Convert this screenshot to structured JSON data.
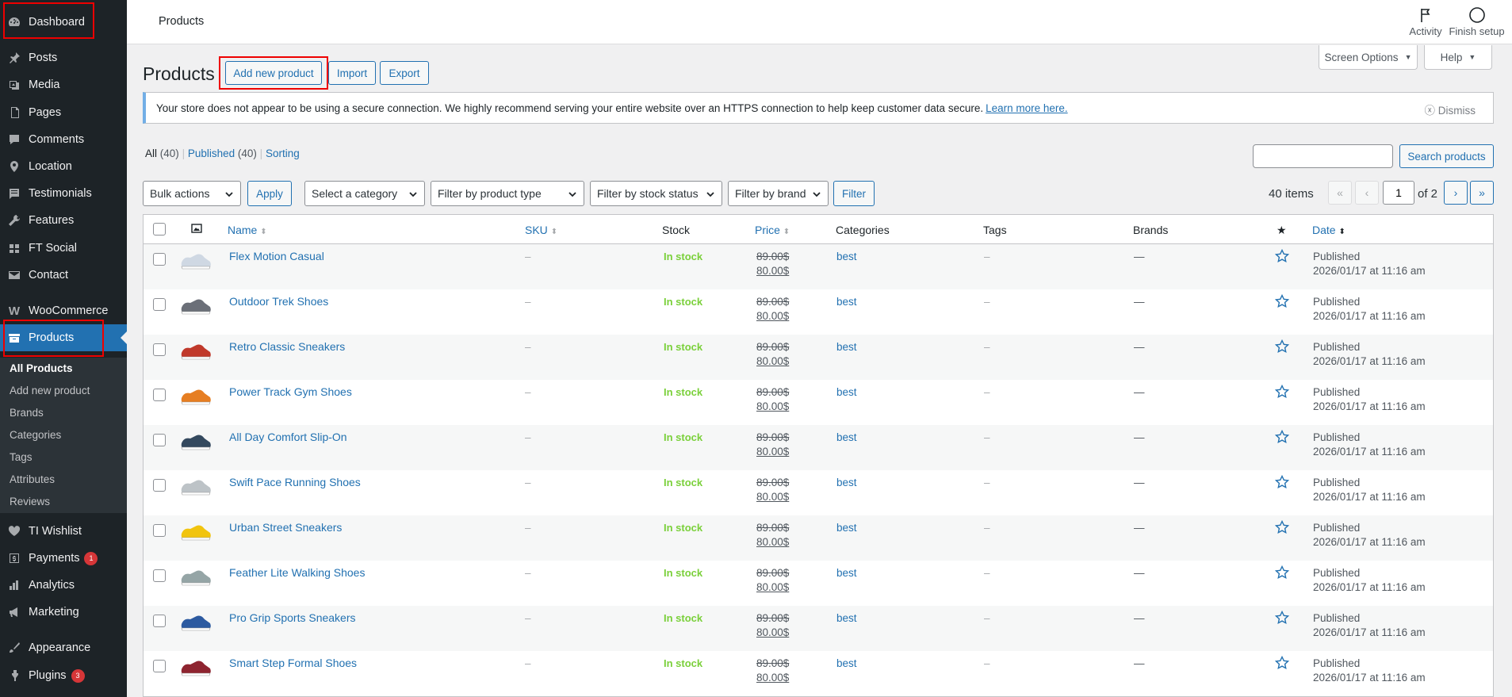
{
  "sidebar": {
    "items": [
      {
        "label": "Dashboard",
        "icon": "dashboard-icon"
      },
      {
        "label": "Posts",
        "icon": "pin-icon"
      },
      {
        "label": "Media",
        "icon": "media-icon"
      },
      {
        "label": "Pages",
        "icon": "pages-icon"
      },
      {
        "label": "Comments",
        "icon": "comments-icon"
      },
      {
        "label": "Location",
        "icon": "location-icon"
      },
      {
        "label": "Testimonials",
        "icon": "testimonials-icon"
      },
      {
        "label": "Features",
        "icon": "wrench-icon"
      },
      {
        "label": "FT Social",
        "icon": "social-icon"
      },
      {
        "label": "Contact",
        "icon": "mail-icon"
      },
      {
        "label": "WooCommerce",
        "icon": "woocommerce-icon"
      },
      {
        "label": "Products",
        "icon": "products-icon"
      },
      {
        "label": "TI Wishlist",
        "icon": "heart-icon"
      },
      {
        "label": "Payments",
        "icon": "payments-icon",
        "badge": "1"
      },
      {
        "label": "Analytics",
        "icon": "analytics-icon"
      },
      {
        "label": "Marketing",
        "icon": "megaphone-icon"
      },
      {
        "label": "Appearance",
        "icon": "brush-icon"
      },
      {
        "label": "Plugins",
        "icon": "plugin-icon",
        "badge": "3"
      }
    ],
    "submenu": [
      "All Products",
      "Add new product",
      "Brands",
      "Categories",
      "Tags",
      "Attributes",
      "Reviews"
    ]
  },
  "topbar": {
    "title": "Products",
    "activity": "Activity",
    "finish_setup": "Finish setup"
  },
  "screen_options": "Screen Options",
  "help": "Help",
  "heading": {
    "title": "Products",
    "add_new": "Add new product",
    "import": "Import",
    "export": "Export"
  },
  "notice": {
    "text": "Your store does not appear to be using a secure connection. We highly recommend serving your entire website over an HTTPS connection to help keep customer data secure.",
    "link": "Learn more here.",
    "dismiss": "Dismiss"
  },
  "views": {
    "all": "All",
    "all_count": "(40)",
    "published": "Published",
    "published_count": "(40)",
    "sorting": "Sorting"
  },
  "search": {
    "button": "Search products",
    "value": ""
  },
  "filters": {
    "bulk": "Bulk actions",
    "apply": "Apply",
    "category": "Select a category",
    "type": "Filter by product type",
    "stock": "Filter by stock status",
    "brand": "Filter by brand",
    "filter": "Filter"
  },
  "pagination": {
    "items": "40 items",
    "current": "1",
    "of": "of 2",
    "first": "«",
    "prev": "‹",
    "next": "›",
    "last": "»"
  },
  "columns": {
    "name": "Name",
    "sku": "SKU",
    "stock": "Stock",
    "price": "Price",
    "categories": "Categories",
    "tags": "Tags",
    "brands": "Brands",
    "date": "Date"
  },
  "products": [
    {
      "name": "Flex Motion Casual",
      "sku": "–",
      "stock": "In stock",
      "price_old": "89.00$",
      "price_new": "80.00$",
      "category": "best",
      "tags": "–",
      "brands": "—",
      "status": "Published",
      "date": "2026/01/17 at 11:16 am"
    },
    {
      "name": "Outdoor Trek Shoes",
      "sku": "–",
      "stock": "In stock",
      "price_old": "89.00$",
      "price_new": "80.00$",
      "category": "best",
      "tags": "–",
      "brands": "—",
      "status": "Published",
      "date": "2026/01/17 at 11:16 am"
    },
    {
      "name": "Retro Classic Sneakers",
      "sku": "–",
      "stock": "In stock",
      "price_old": "89.00$",
      "price_new": "80.00$",
      "category": "best",
      "tags": "–",
      "brands": "—",
      "status": "Published",
      "date": "2026/01/17 at 11:16 am"
    },
    {
      "name": "Power Track Gym Shoes",
      "sku": "–",
      "stock": "In stock",
      "price_old": "89.00$",
      "price_new": "80.00$",
      "category": "best",
      "tags": "–",
      "brands": "—",
      "status": "Published",
      "date": "2026/01/17 at 11:16 am"
    },
    {
      "name": "All Day Comfort Slip-On",
      "sku": "–",
      "stock": "In stock",
      "price_old": "89.00$",
      "price_new": "80.00$",
      "category": "best",
      "tags": "–",
      "brands": "—",
      "status": "Published",
      "date": "2026/01/17 at 11:16 am"
    },
    {
      "name": "Swift Pace Running Shoes",
      "sku": "–",
      "stock": "In stock",
      "price_old": "89.00$",
      "price_new": "80.00$",
      "category": "best",
      "tags": "–",
      "brands": "—",
      "status": "Published",
      "date": "2026/01/17 at 11:16 am"
    },
    {
      "name": "Urban Street Sneakers",
      "sku": "–",
      "stock": "In stock",
      "price_old": "89.00$",
      "price_new": "80.00$",
      "category": "best",
      "tags": "–",
      "brands": "—",
      "status": "Published",
      "date": "2026/01/17 at 11:16 am"
    },
    {
      "name": "Feather Lite Walking Shoes",
      "sku": "–",
      "stock": "In stock",
      "price_old": "89.00$",
      "price_new": "80.00$",
      "category": "best",
      "tags": "–",
      "brands": "—",
      "status": "Published",
      "date": "2026/01/17 at 11:16 am"
    },
    {
      "name": "Pro Grip Sports Sneakers",
      "sku": "–",
      "stock": "In stock",
      "price_old": "89.00$",
      "price_new": "80.00$",
      "category": "best",
      "tags": "–",
      "brands": "—",
      "status": "Published",
      "date": "2026/01/17 at 11:16 am"
    },
    {
      "name": "Smart Step Formal Shoes",
      "sku": "–",
      "stock": "In stock",
      "price_old": "89.00$",
      "price_new": "80.00$",
      "category": "best",
      "tags": "–",
      "brands": "—",
      "status": "Published",
      "date": "2026/01/17 at 11:16 am"
    }
  ],
  "colors": {
    "sidebar_bg": "#1d2327",
    "accent": "#2271b1",
    "in_stock": "#7ad03a",
    "highlight": "#e00000"
  }
}
